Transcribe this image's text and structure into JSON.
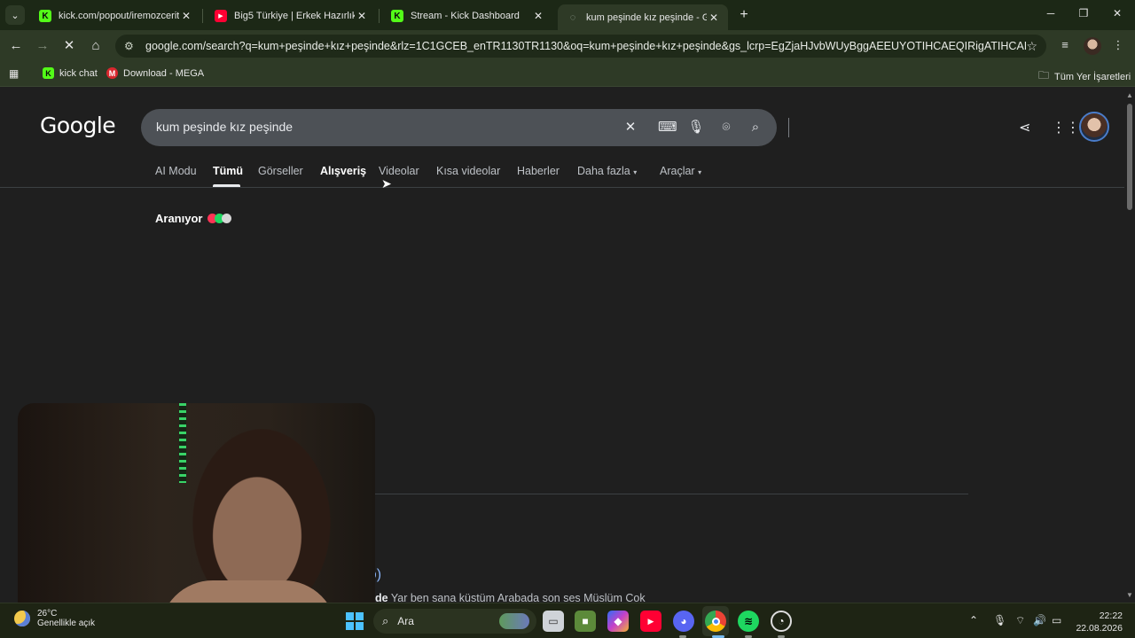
{
  "tabs": [
    {
      "title": "kick.com/popout/iremozceritt/c",
      "favicon": "kick-icon"
    },
    {
      "title": "Big5 Türkiye | Erkek Hazırlık Sez",
      "favicon": "youtube-icon"
    },
    {
      "title": "Stream - Kick Dashboard",
      "favicon": "kick-icon"
    },
    {
      "title": "kum peşinde kız peşinde - Goog",
      "favicon": "google-loading-icon",
      "active": true
    }
  ],
  "toolbar": {
    "url": "google.com/search?q=kum+peşinde+kız+peşinde&rlz=1C1GCEB_enTR1130TR1130&oq=kum+peşinde+kız+peşinde&gs_lcrp=EgZjaHJvbWUyBggAEEUYOTIHCAEQIRigATIHCAIQIRigATIHCA..."
  },
  "bookmarks": {
    "items": [
      {
        "label": "kick chat",
        "icon": "kick-icon"
      },
      {
        "label": "Download - MEGA",
        "icon": "mega-icon"
      }
    ],
    "all_label": "Tüm Yer İşaretleri"
  },
  "google": {
    "logo": "Google",
    "query": "kum peşinde kız peşinde",
    "tabs": [
      "AI Modu",
      "Tümü",
      "Görseller",
      "Alışveriş",
      "Videolar",
      "Kısa videolar",
      "Haberler",
      "Daha fazla",
      "Araçlar"
    ],
    "active_tab": "Tümü",
    "searching_label": "Aranıyor",
    "result_title_fragment": "deo)",
    "result_snippet_bold": "eşinde",
    "result_snippet_rest": " Yar ben sana küstüm Arabada son ses Müslüm Cok"
  },
  "taskbar": {
    "weather_temp": "26°C",
    "weather_desc": "Genellikle açık",
    "search_placeholder": "Ara",
    "time": "22:22",
    "date": "22.08.2026"
  },
  "colors": {
    "tabstrip": "#1c2816",
    "toolbar": "#2e3a26",
    "page_bg": "#1f1f1f",
    "searchbox": "#4d5156",
    "link": "#8ab4f8",
    "kick_green": "#53fc18"
  }
}
